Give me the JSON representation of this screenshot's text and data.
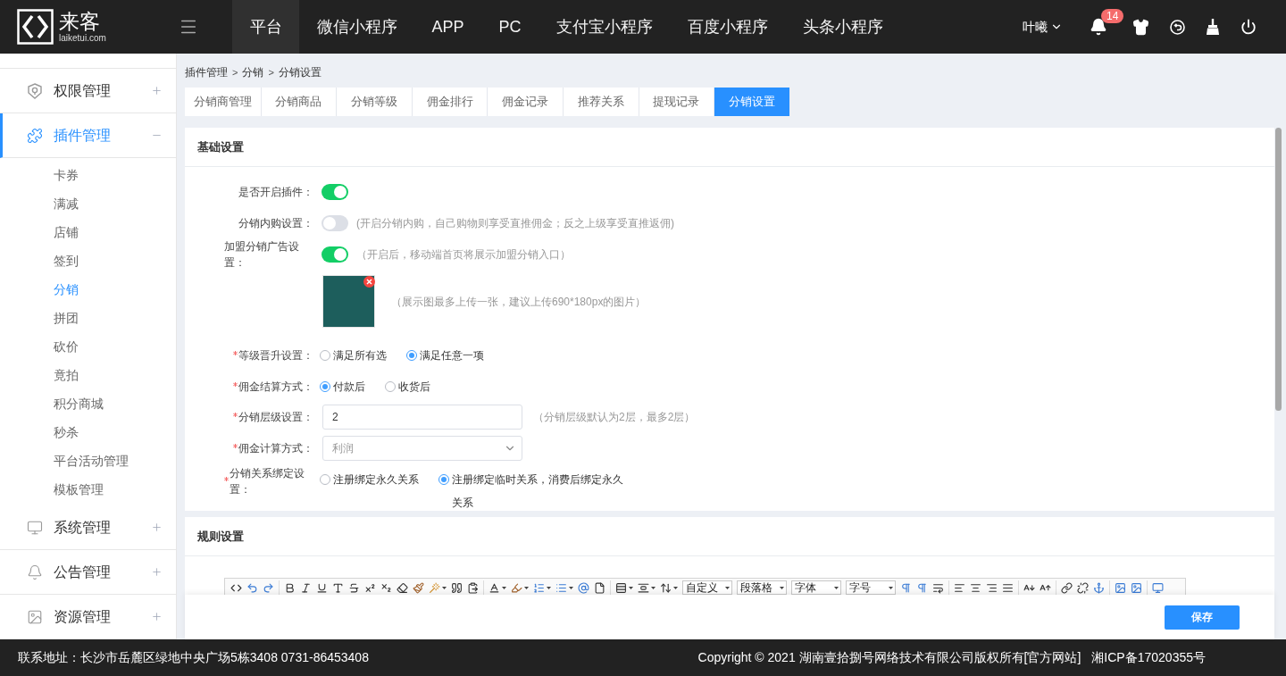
{
  "header": {
    "logo": {
      "name": "来客",
      "domain": "laiketui.com"
    },
    "nav": [
      {
        "label": "平台",
        "selected": true
      },
      {
        "label": "微信小程序",
        "selected": false
      },
      {
        "label": "APP",
        "selected": false
      },
      {
        "label": "PC",
        "selected": false
      },
      {
        "label": "支付宝小程序",
        "selected": false
      },
      {
        "label": "百度小程序",
        "selected": false
      },
      {
        "label": "头条小程序",
        "selected": false
      }
    ],
    "user": "叶曦",
    "notification_count": "14"
  },
  "sidebar": {
    "items": [
      {
        "label": "权限管理",
        "selected": false,
        "expanded": false
      },
      {
        "label": "插件管理",
        "selected": true,
        "expanded": true,
        "children": [
          {
            "label": "卡券",
            "selected": false
          },
          {
            "label": "满减",
            "selected": false
          },
          {
            "label": "店铺",
            "selected": false
          },
          {
            "label": "签到",
            "selected": false
          },
          {
            "label": "分销",
            "selected": true
          },
          {
            "label": "拼团",
            "selected": false
          },
          {
            "label": "砍价",
            "selected": false
          },
          {
            "label": "竟拍",
            "selected": false
          },
          {
            "label": "积分商城",
            "selected": false
          },
          {
            "label": "秒杀",
            "selected": false
          },
          {
            "label": "平台活动管理",
            "selected": false
          },
          {
            "label": "模板管理",
            "selected": false
          }
        ]
      },
      {
        "label": "系统管理",
        "selected": false,
        "expanded": false
      },
      {
        "label": "公告管理",
        "selected": false,
        "expanded": false
      },
      {
        "label": "资源管理",
        "selected": false,
        "expanded": false
      }
    ]
  },
  "breadcrumb": {
    "items": [
      "插件管理",
      "分销",
      "分销设置"
    ],
    "separator": ">"
  },
  "tabs": [
    {
      "label": "分销商管理",
      "selected": false
    },
    {
      "label": "分销商品",
      "selected": false
    },
    {
      "label": "分销等级",
      "selected": false
    },
    {
      "label": "佣金排行",
      "selected": false
    },
    {
      "label": "佣金记录",
      "selected": false
    },
    {
      "label": "推荐关系",
      "selected": false
    },
    {
      "label": "提现记录",
      "selected": false
    },
    {
      "label": "分销设置",
      "selected": true
    }
  ],
  "basic_settings": {
    "title": "基础设置",
    "fields": [
      {
        "kind": "toggle",
        "label": "是否开启插件：",
        "required": false,
        "on": true
      },
      {
        "kind": "toggle",
        "label": "分销内购设置：",
        "required": false,
        "on": false,
        "hint": "(开启分销内购，自己购物则享受直推佣金；反之上级享受直推返佣)"
      },
      {
        "kind": "toggle",
        "label": "加盟分销广告设置：",
        "required": false,
        "on": true,
        "hint": "（开启后，移动端首页将展示加盟分销入口）"
      },
      {
        "kind": "image",
        "hint": "（展示图最多上传一张，建议上传690*180px的图片）"
      },
      {
        "kind": "radio",
        "label": "等级晋升设置：",
        "required": true,
        "options": [
          {
            "label": "满足所有选",
            "selected": false
          },
          {
            "label": "满足任意一项",
            "selected": true
          }
        ]
      },
      {
        "kind": "radio",
        "label": "佣金结算方式：",
        "required": true,
        "options": [
          {
            "label": "付款后",
            "selected": true
          },
          {
            "label": "收货后",
            "selected": false
          }
        ]
      },
      {
        "kind": "input",
        "label": "分销层级设置：",
        "required": true,
        "value": "2",
        "hint": "（分销层级默认为2层，最多2层）"
      },
      {
        "kind": "select",
        "label": "佣金计算方式：",
        "required": true,
        "value": "利润"
      },
      {
        "kind": "radio",
        "label": "分销关系绑定设置：",
        "required": true,
        "options": [
          {
            "label": "注册绑定永久关系",
            "selected": false
          },
          {
            "label": "注册绑定临时关系，消费后绑定永久关系",
            "selected": true
          }
        ]
      }
    ]
  },
  "rule_settings": {
    "title": "规则设置",
    "editor": {
      "selects": [
        "自定义",
        "段落格",
        "字体",
        "字号"
      ]
    }
  },
  "save_button": "保存",
  "footer": {
    "address": "联系地址：长沙市岳麓区绿地中央广场5栋3408 0731-86453408",
    "copyright": "Copyright © 2021 湖南壹拾捌号网络技术有限公司版权所有",
    "site_link": "[官方网站]",
    "icp": "湘ICP备17020355号"
  }
}
